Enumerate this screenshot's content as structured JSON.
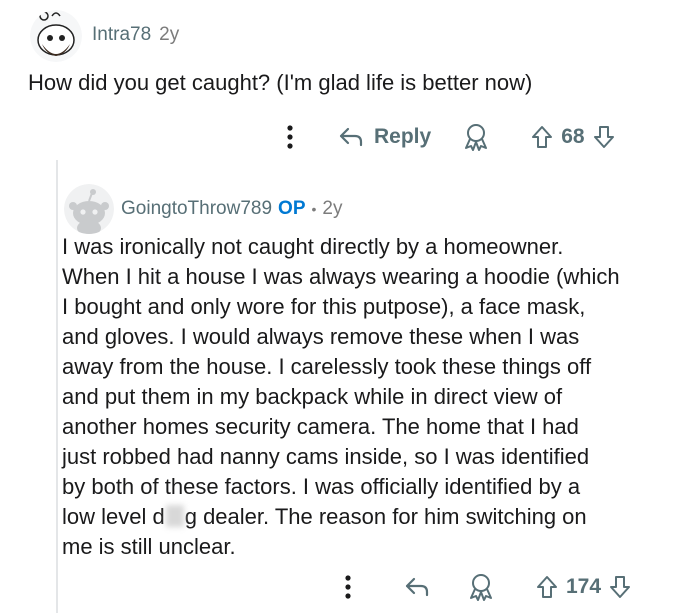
{
  "comment1": {
    "username": "Intra78",
    "age": "2y",
    "text": "How did you get caught? (I'm glad life is better now)",
    "actions": {
      "reply_label": "Reply",
      "votes": "68"
    }
  },
  "comment2": {
    "username": "GoingtoThrow789",
    "op_badge": "OP",
    "separator": "•",
    "age": "2y",
    "lines": [
      "I was ironically not caught directly by a homeowner.",
      "When I hit a house I was always wearing a hoodie (which",
      "I bought and only wore for this putpose), a face mask,",
      "and gloves. I would always remove these when I was",
      "away from the house. I carelessly took these things off",
      "and put them in my backpack while in direct view of",
      "another homes security camera. The home that I had",
      "just robbed had nanny cams inside, so I was identified",
      "by both of these factors. I was officially identified by a"
    ],
    "line10_part1": "low level d",
    "line10_part2": "g dealer. The reason for him switching on",
    "line11": "me is still unclear.",
    "actions": {
      "votes": "174"
    }
  },
  "colors": {
    "op": "#0079d3",
    "meta": "#576f76",
    "text": "#1a1a1b"
  }
}
